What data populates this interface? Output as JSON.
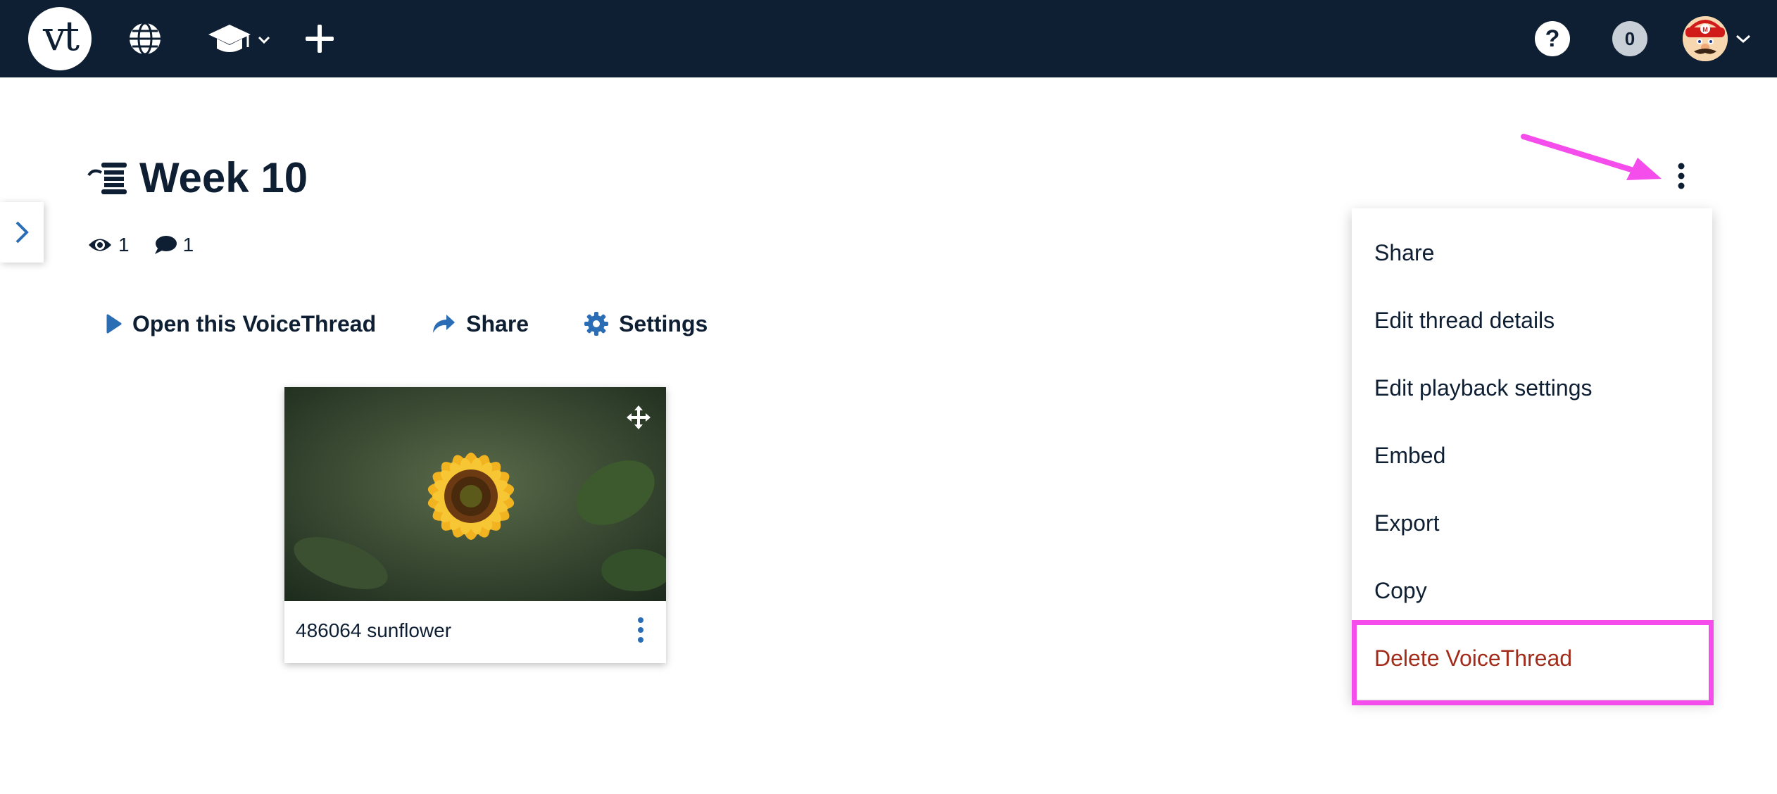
{
  "topbar": {
    "logo_text": "vt",
    "icons": [
      "globe-icon",
      "graduation-cap-icon",
      "plus-icon",
      "help-icon",
      "avatar"
    ],
    "help_label": "?",
    "notification_count": "0"
  },
  "thread": {
    "title": "Week 10",
    "views": "1",
    "comments": "1"
  },
  "actions": {
    "open": "Open this VoiceThread",
    "share": "Share",
    "settings": "Settings"
  },
  "slide": {
    "label": "486064 sunflower"
  },
  "menu": {
    "items": [
      "Share",
      "Edit thread details",
      "Edit playback settings",
      "Embed",
      "Export",
      "Copy",
      "Delete VoiceThread"
    ]
  },
  "colors": {
    "navbar": "#0f1f33",
    "accent_blue": "#2a6db5",
    "danger": "#a32b1a",
    "highlight": "#f54dec"
  }
}
